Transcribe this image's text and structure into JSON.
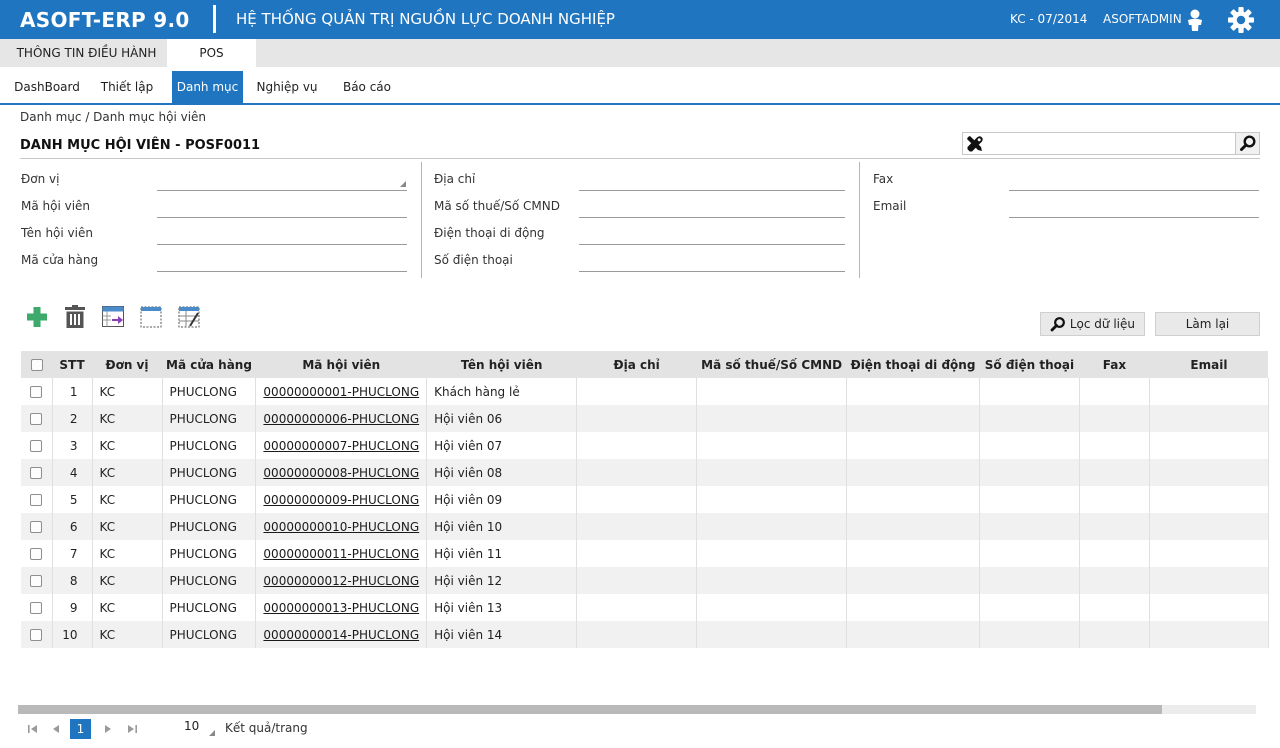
{
  "header": {
    "logo": "ASOFT-ERP 9.0",
    "title": "HỆ THỐNG QUẢN TRỊ NGUỒN LỰC DOANH NGHIỆP",
    "period": "KC - 07/2014",
    "user": "ASOFTADMIN",
    "user_icon": "user-icon",
    "settings_icon": "gear-icon"
  },
  "modules": [
    {
      "label": "THÔNG TIN ĐIỀU HÀNH",
      "active": false
    },
    {
      "label": "POS",
      "active": true
    }
  ],
  "menu": [
    {
      "label": "DashBoard",
      "active": false
    },
    {
      "label": "Thiết lập",
      "active": false
    },
    {
      "label": "Danh mục",
      "active": true
    },
    {
      "label": "Nghiệp vụ",
      "active": false
    },
    {
      "label": "Báo cáo",
      "active": false
    }
  ],
  "breadcrumb": "Danh mục / Danh mục hội viên",
  "page_title": "DANH MỤC HỘI VIÊN - POSF0011",
  "quick_search": {
    "value": "",
    "placeholder": ""
  },
  "filters": {
    "don_vi": {
      "label": "Đơn vị",
      "value": ""
    },
    "ma_hoi_vien": {
      "label": "Mã hội viên",
      "value": ""
    },
    "ten_hoi_vien": {
      "label": "Tên hội viên",
      "value": ""
    },
    "ma_cua_hang": {
      "label": "Mã cửa hàng",
      "value": ""
    },
    "dia_chi": {
      "label": "Địa chỉ",
      "value": ""
    },
    "ma_so_thue": {
      "label": "Mã số thuế/Số CMND",
      "value": ""
    },
    "dien_thoai_di_dong": {
      "label": "Điện thoại di động",
      "value": ""
    },
    "so_dien_thoai": {
      "label": "Số điện thoại",
      "value": ""
    },
    "fax": {
      "label": "Fax",
      "value": ""
    },
    "email": {
      "label": "Email",
      "value": ""
    }
  },
  "toolbar": {
    "icons": [
      "add-icon",
      "delete-icon",
      "export-icon",
      "column-select-icon",
      "grid-config-icon"
    ],
    "filter_button": "Lọc dữ liệu",
    "reset_button": "Làm lại"
  },
  "grid": {
    "columns": [
      "STT",
      "Đơn vị",
      "Mã cửa hàng",
      "Mã hội viên",
      "Tên hội viên",
      "Địa chỉ",
      "Mã số thuế/Số CMND",
      "Điện thoại di động",
      "Số điện thoại",
      "Fax",
      "Email"
    ],
    "rows": [
      {
        "stt": "1",
        "don_vi": "KC",
        "ma_cua_hang": "PHUCLONG",
        "ma_hoi_vien": "00000000001-PHUCLONG",
        "ten_hoi_vien": "Khách hàng lẻ",
        "dia_chi": "",
        "ma_so_thue": "",
        "dien_thoai_di_dong": "",
        "so_dien_thoai": "",
        "fax": "",
        "email": ""
      },
      {
        "stt": "2",
        "don_vi": "KC",
        "ma_cua_hang": "PHUCLONG",
        "ma_hoi_vien": "00000000006-PHUCLONG",
        "ten_hoi_vien": "Hội viên 06",
        "dia_chi": "",
        "ma_so_thue": "",
        "dien_thoai_di_dong": "",
        "so_dien_thoai": "",
        "fax": "",
        "email": ""
      },
      {
        "stt": "3",
        "don_vi": "KC",
        "ma_cua_hang": "PHUCLONG",
        "ma_hoi_vien": "00000000007-PHUCLONG",
        "ten_hoi_vien": "Hội viên 07",
        "dia_chi": "",
        "ma_so_thue": "",
        "dien_thoai_di_dong": "",
        "so_dien_thoai": "",
        "fax": "",
        "email": ""
      },
      {
        "stt": "4",
        "don_vi": "KC",
        "ma_cua_hang": "PHUCLONG",
        "ma_hoi_vien": "00000000008-PHUCLONG",
        "ten_hoi_vien": "Hội viên 08",
        "dia_chi": "",
        "ma_so_thue": "",
        "dien_thoai_di_dong": "",
        "so_dien_thoai": "",
        "fax": "",
        "email": ""
      },
      {
        "stt": "5",
        "don_vi": "KC",
        "ma_cua_hang": "PHUCLONG",
        "ma_hoi_vien": "00000000009-PHUCLONG",
        "ten_hoi_vien": "Hội viên 09",
        "dia_chi": "",
        "ma_so_thue": "",
        "dien_thoai_di_dong": "",
        "so_dien_thoai": "",
        "fax": "",
        "email": ""
      },
      {
        "stt": "6",
        "don_vi": "KC",
        "ma_cua_hang": "PHUCLONG",
        "ma_hoi_vien": "00000000010-PHUCLONG",
        "ten_hoi_vien": "Hội viên 10",
        "dia_chi": "",
        "ma_so_thue": "",
        "dien_thoai_di_dong": "",
        "so_dien_thoai": "",
        "fax": "",
        "email": ""
      },
      {
        "stt": "7",
        "don_vi": "KC",
        "ma_cua_hang": "PHUCLONG",
        "ma_hoi_vien": "00000000011-PHUCLONG",
        "ten_hoi_vien": "Hội viên 11",
        "dia_chi": "",
        "ma_so_thue": "",
        "dien_thoai_di_dong": "",
        "so_dien_thoai": "",
        "fax": "",
        "email": ""
      },
      {
        "stt": "8",
        "don_vi": "KC",
        "ma_cua_hang": "PHUCLONG",
        "ma_hoi_vien": "00000000012-PHUCLONG",
        "ten_hoi_vien": "Hội viên 12",
        "dia_chi": "",
        "ma_so_thue": "",
        "dien_thoai_di_dong": "",
        "so_dien_thoai": "",
        "fax": "",
        "email": ""
      },
      {
        "stt": "9",
        "don_vi": "KC",
        "ma_cua_hang": "PHUCLONG",
        "ma_hoi_vien": "00000000013-PHUCLONG",
        "ten_hoi_vien": "Hội viên 13",
        "dia_chi": "",
        "ma_so_thue": "",
        "dien_thoai_di_dong": "",
        "so_dien_thoai": "",
        "fax": "",
        "email": ""
      },
      {
        "stt": "10",
        "don_vi": "KC",
        "ma_cua_hang": "PHUCLONG",
        "ma_hoi_vien": "00000000014-PHUCLONG",
        "ten_hoi_vien": "Hội viên 14",
        "dia_chi": "",
        "ma_so_thue": "",
        "dien_thoai_di_dong": "",
        "so_dien_thoai": "",
        "fax": "",
        "email": ""
      }
    ]
  },
  "pager": {
    "current_page": "1",
    "page_size": "10",
    "page_size_label": "Kết quả/trang",
    "first_icon": "first-page-icon",
    "prev_icon": "prev-page-icon",
    "next_icon": "next-page-icon",
    "last_icon": "last-page-icon"
  },
  "colors": {
    "brand": "#1f75bf",
    "header_bg": "#1f75bf",
    "grid_header_bg": "#e3e3e3",
    "alt_row_bg": "#f1f1f1",
    "add_icon": "#3daa6c"
  }
}
